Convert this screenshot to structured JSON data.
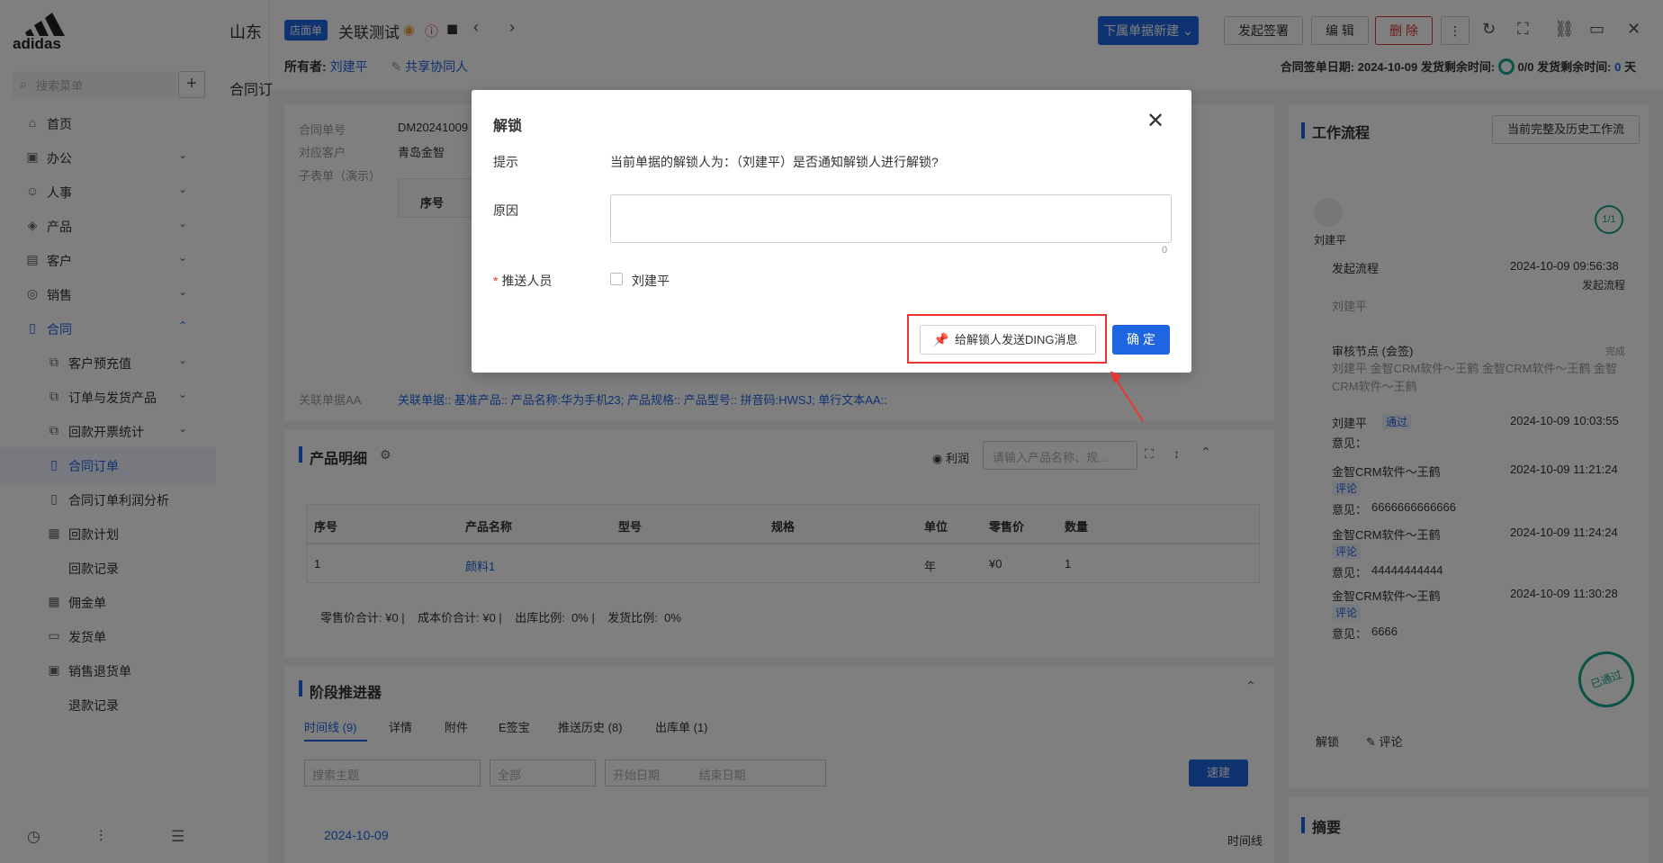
{
  "brand": {
    "logo": "adidas"
  },
  "sidebar": {
    "search_placeholder": "搜索菜单",
    "items": [
      {
        "label": "首页",
        "icon": "home-icon"
      },
      {
        "label": "办公",
        "icon": "office-icon"
      },
      {
        "label": "人事",
        "icon": "people-icon"
      },
      {
        "label": "产品",
        "icon": "box-icon"
      },
      {
        "label": "客户",
        "icon": "customer-icon"
      },
      {
        "label": "销售",
        "icon": "sales-icon"
      },
      {
        "label": "合同",
        "icon": "contract-icon"
      },
      {
        "label": "客户预充值",
        "icon": "copy-icon"
      },
      {
        "label": "订单与发货产品",
        "icon": "copy-icon"
      },
      {
        "label": "回款开票统计",
        "icon": "copy-icon"
      },
      {
        "label": "合同订单",
        "icon": "doc-icon"
      },
      {
        "label": "合同订单利润分析",
        "icon": "doc-icon"
      },
      {
        "label": "回款计划",
        "icon": "calendar-icon"
      },
      {
        "label": "回款记录",
        "icon": ""
      },
      {
        "label": "佣金单",
        "icon": "grid-icon"
      },
      {
        "label": "发货单",
        "icon": "truck-icon"
      },
      {
        "label": "销售退货单",
        "icon": "return-icon"
      },
      {
        "label": "退款记录",
        "icon": ""
      }
    ]
  },
  "header": {
    "company": "山东",
    "badge": "店面单",
    "title": "关联测试",
    "buttons": {
      "new_sub": "下属单据新建",
      "sign": "发起签署",
      "edit": "编 辑",
      "delete": "删 除"
    },
    "owner_label": "所有者:",
    "owner": "刘建平",
    "share": "共享协同人",
    "sign_date_label": "合同签单日期:",
    "sign_date": "2024-10-09",
    "ship_remain_label": "发货剩余时间:",
    "ship_progress": "0/0",
    "ship_remain_label2": "发货剩余时间:",
    "ship_days": "0",
    "ship_unit": "天"
  },
  "page": {
    "crumb": "合同订"
  },
  "detail": {
    "rows": [
      {
        "label": "合同单号",
        "value": "DM20241009"
      },
      {
        "label": "对应客户",
        "value": "青岛金智"
      },
      {
        "label": "子表单（演示）",
        "value": ""
      }
    ],
    "subtable_header": "序号",
    "related_label": "关联单据AA",
    "related_value": "关联单据:: 基准产品:: 产品名称:华为手机23; 产品规格:: 产品型号:: 拼音码:HWSJ; 单行文本AA::"
  },
  "products": {
    "title": "产品明细",
    "profit": "利润",
    "search_placeholder": "请输入产品名称、规...",
    "columns": [
      "序号",
      "产品名称",
      "型号",
      "规格",
      "单位",
      "零售价",
      "数量"
    ],
    "rows": [
      {
        "no": "1",
        "name": "颜料1",
        "model": "",
        "spec": "",
        "unit": "年",
        "price": "¥0",
        "qty": "1"
      }
    ],
    "summary": "零售价合计: ¥0 |    成本价合计: ¥0 |    出库比例:  0% |    发货比例:  0%"
  },
  "stage": {
    "title": "阶段推进器",
    "tabs": [
      "时间线 (9)",
      "详情",
      "附件",
      "E签宝",
      "推送历史 (8)",
      "出库单 (1)"
    ],
    "search_placeholder": "搜索主题",
    "select": "全部",
    "start_placeholder": "开始日期",
    "end_placeholder": "结束日期",
    "quick": "速建",
    "date": "2024-10-09",
    "timeline_label": "时间线"
  },
  "workflow": {
    "title": "工作流程",
    "history_btn": "当前完整及历史工作流",
    "user": "刘建平",
    "progress": "1/1",
    "start_label": "发起流程",
    "start_time": "2024-10-09 09:56:38",
    "start_status": "发起流程",
    "start_user": "刘建平",
    "review_label": "审核节点 (会签)",
    "review_status": "完成",
    "review_users": "刘建平 金智CRM软件～王鹤 金智CRM软件～王鹤 金智CRM软件～王鹤",
    "entries": [
      {
        "user": "刘建平",
        "tag": "通过",
        "time": "2024-10-09 10:03:55",
        "opinion_label": "意见：",
        "opinion": ""
      },
      {
        "user": "金智CRM软件～王鹤",
        "tag": "评论",
        "time": "2024-10-09 11:21:24",
        "opinion_label": "意见：",
        "opinion": "6666666666666"
      },
      {
        "user": "金智CRM软件～王鹤",
        "tag": "评论",
        "time": "2024-10-09 11:24:24",
        "opinion_label": "意见：",
        "opinion": "44444444444"
      },
      {
        "user": "金智CRM软件～王鹤",
        "tag": "评论",
        "time": "2024-10-09 11:30:28",
        "opinion_label": "意见：",
        "opinion": "6666"
      }
    ],
    "unlock": "解锁",
    "comment": "评论",
    "stamp": "已通过",
    "summary_title": "摘要"
  },
  "modal": {
    "title": "解锁",
    "hint_label": "提示",
    "hint": "当前单据的解锁人为：（刘建平）是否通知解锁人进行解锁?",
    "reason_label": "原因",
    "reason_count": "0",
    "push_label": "推送人员",
    "push_user": "刘建平",
    "ding_btn": "给解锁人发送DING消息",
    "ok_btn": "确 定"
  },
  "colors": {
    "primary": "#1f64e0",
    "danger": "#dd3333",
    "accent_green": "#17a58e"
  }
}
